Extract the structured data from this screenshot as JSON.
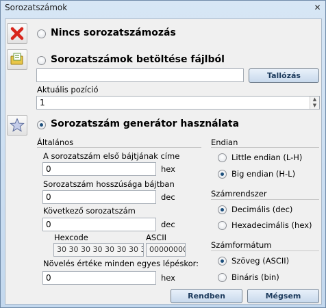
{
  "window": {
    "title": "Sorozatszámok",
    "close_glyph": "✕"
  },
  "options": {
    "none_label": "Nincs sorozatszámozás",
    "file_label": "Sorozatszámok betöltése fájlból",
    "generator_label": "Sorozatszám generátor használata"
  },
  "file": {
    "path_value": "",
    "browse_label": "Tallózás",
    "position_label": "Aktuális pozíció",
    "position_value": "1"
  },
  "general": {
    "heading": "Általános",
    "first_byte_label": "A sorozatszám első bájtjának címe",
    "first_byte_value": "0",
    "first_byte_unit": "hex",
    "length_label": "Sorozatszám hosszúsága bájtban",
    "length_value": "0",
    "length_unit": "dec",
    "next_label": "Következő sorozatszám",
    "next_value": "0",
    "next_unit": "dec",
    "hexcode_label": "Hexcode",
    "hexcode_value": "30 30 30 30 30 30 30 30",
    "ascii_label": "ASCII",
    "ascii_value": "00000000",
    "increment_label": "Növelés értéke minden egyes lépéskor:",
    "increment_value": "0",
    "increment_unit": "hex"
  },
  "endian": {
    "heading": "Endian",
    "little": "Little endian (L-H)",
    "big": "Big endian (H-L)"
  },
  "numsys": {
    "heading": "Számrendszer",
    "decimal": "Decimális (dec)",
    "hex": "Hexadecimális (hex)"
  },
  "numformat": {
    "heading": "Számformátum",
    "text": "Szöveg (ASCII)",
    "binary": "Bináris (bin)"
  },
  "buttons": {
    "ok": "Rendben",
    "cancel": "Mégsem"
  },
  "icons": {
    "none": "red-x-icon",
    "file": "folder-file-icon",
    "generator": "star-icon",
    "spin_up": "▲",
    "spin_down": "▼"
  }
}
